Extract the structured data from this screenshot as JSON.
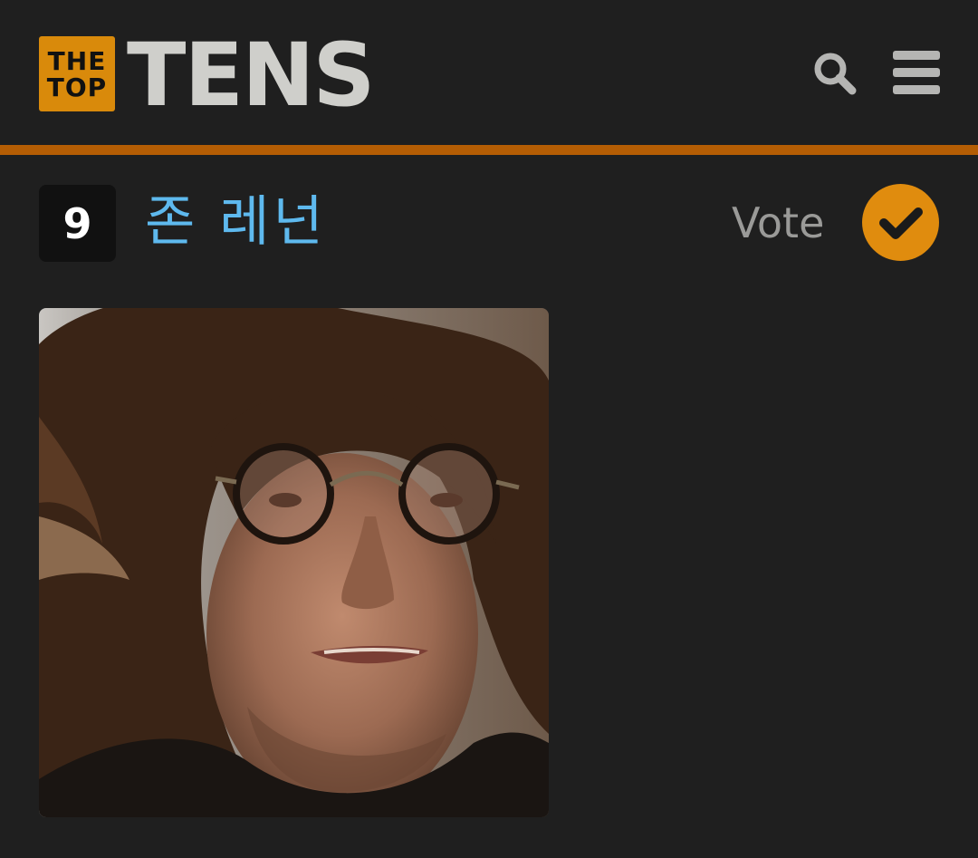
{
  "header": {
    "logo_line1": "THE",
    "logo_line2": "TOP",
    "logo_wordmark": "TENS",
    "search_icon": "search-icon",
    "menu_icon": "hamburger-menu-icon"
  },
  "item": {
    "rank": "9",
    "title": "존 레넌",
    "vote_label": "Vote",
    "vote_icon": "checkmark-icon"
  },
  "colors": {
    "background": "#1f1f1f",
    "accent": "#e08c0e",
    "accent_bar": "#b45d04",
    "title_link": "#5eb9ee"
  }
}
